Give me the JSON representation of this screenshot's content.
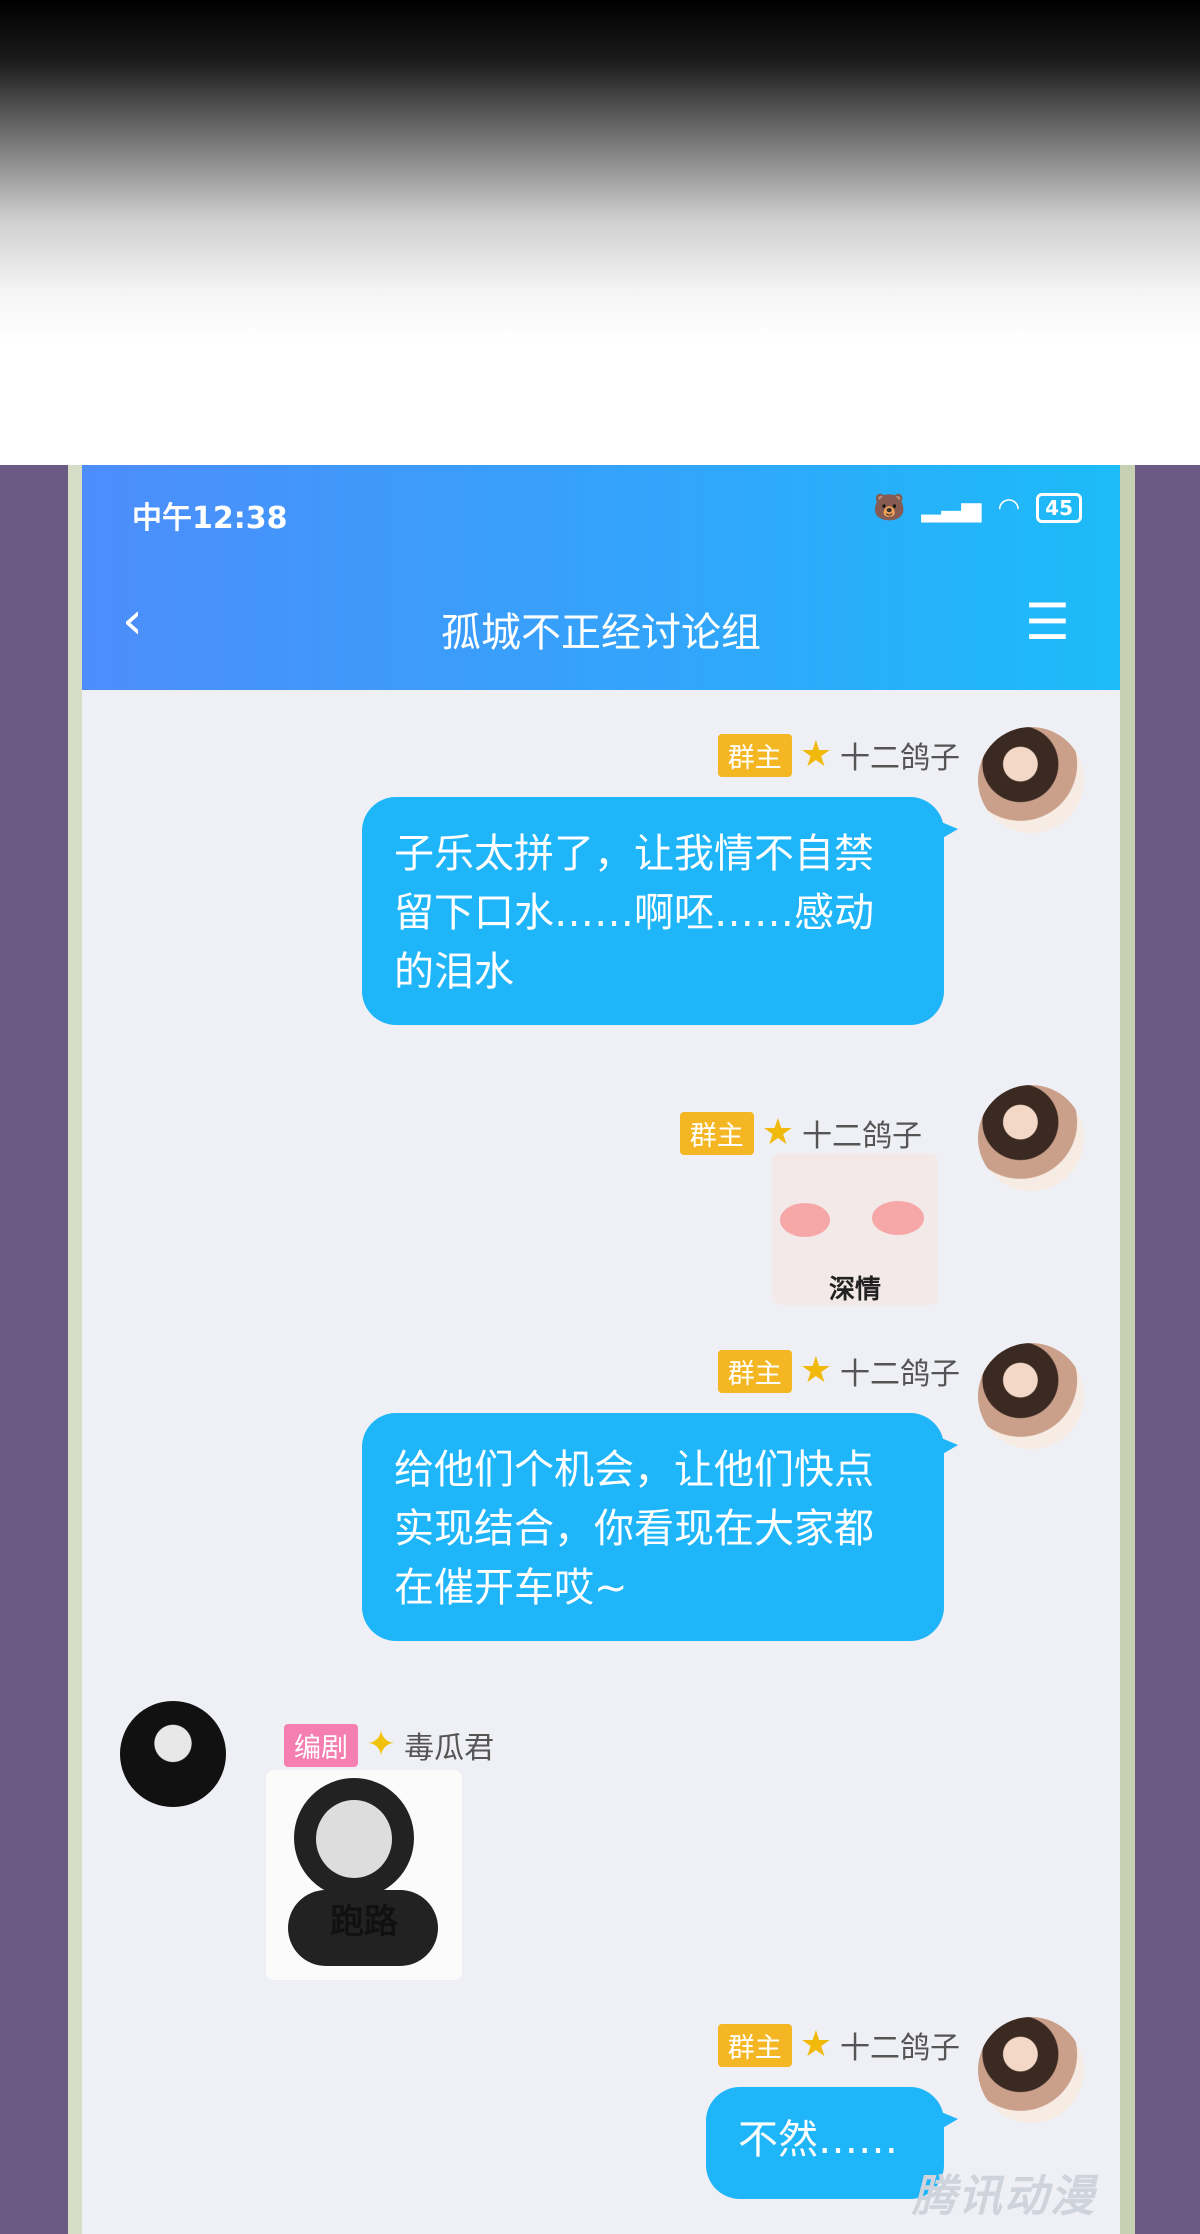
{
  "status_bar": {
    "time": "中午12:38",
    "battery": "45"
  },
  "header": {
    "title": "孤城不正经讨论组"
  },
  "messages": [
    {
      "role_badge": "群主",
      "sender": "十二鸽子",
      "text": "子乐太拼了，让我情不自禁留下口水……啊呸……感动的泪水"
    },
    {
      "role_badge": "群主",
      "sender": "十二鸽子",
      "sticker_caption": "深情"
    },
    {
      "role_badge": "群主",
      "sender": "十二鸽子",
      "text": "给他们个机会，让他们快点实现结合，你看现在大家都在催开车哎~"
    },
    {
      "role_badge": "编剧",
      "sender": "毒瓜君",
      "sticker_caption": "跑路"
    },
    {
      "role_badge": "群主",
      "sender": "十二鸽子",
      "text": "不然……"
    }
  ],
  "watermark": "腾讯动漫"
}
